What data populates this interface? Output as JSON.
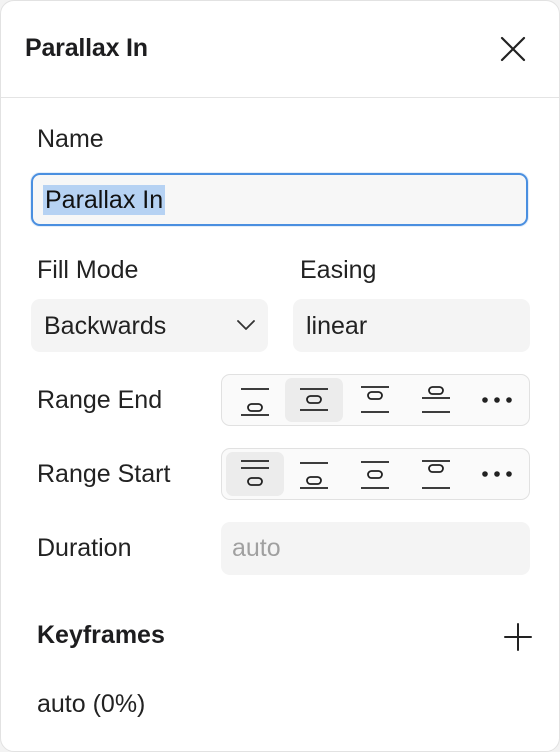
{
  "panel": {
    "title": "Parallax In",
    "close_icon": "close-icon"
  },
  "name": {
    "label": "Name",
    "value": "Parallax In"
  },
  "fill_mode": {
    "label": "Fill Mode",
    "selected": "Backwards"
  },
  "easing": {
    "label": "Easing",
    "value": "linear"
  },
  "range_end": {
    "label": "Range End",
    "options": [
      "align-top-start-icon",
      "align-top-center-icon",
      "align-top-end-icon",
      "align-top-edge-icon",
      "more-icon"
    ],
    "selected_index": 1
  },
  "range_start": {
    "label": "Range Start",
    "options": [
      "align-top-start-icon",
      "align-top-center-icon",
      "align-top-end-icon",
      "align-top-edge-icon",
      "more-icon"
    ],
    "selected_index": 0
  },
  "duration": {
    "label": "Duration",
    "placeholder": "auto"
  },
  "keyframes": {
    "title": "Keyframes",
    "add_icon": "plus-icon",
    "items": [
      "auto (0%)"
    ]
  },
  "colors": {
    "focus": "#4a8fe0",
    "selection": "#b6d2f3",
    "field_bg": "#f4f4f4",
    "active_segment": "#ececec"
  }
}
